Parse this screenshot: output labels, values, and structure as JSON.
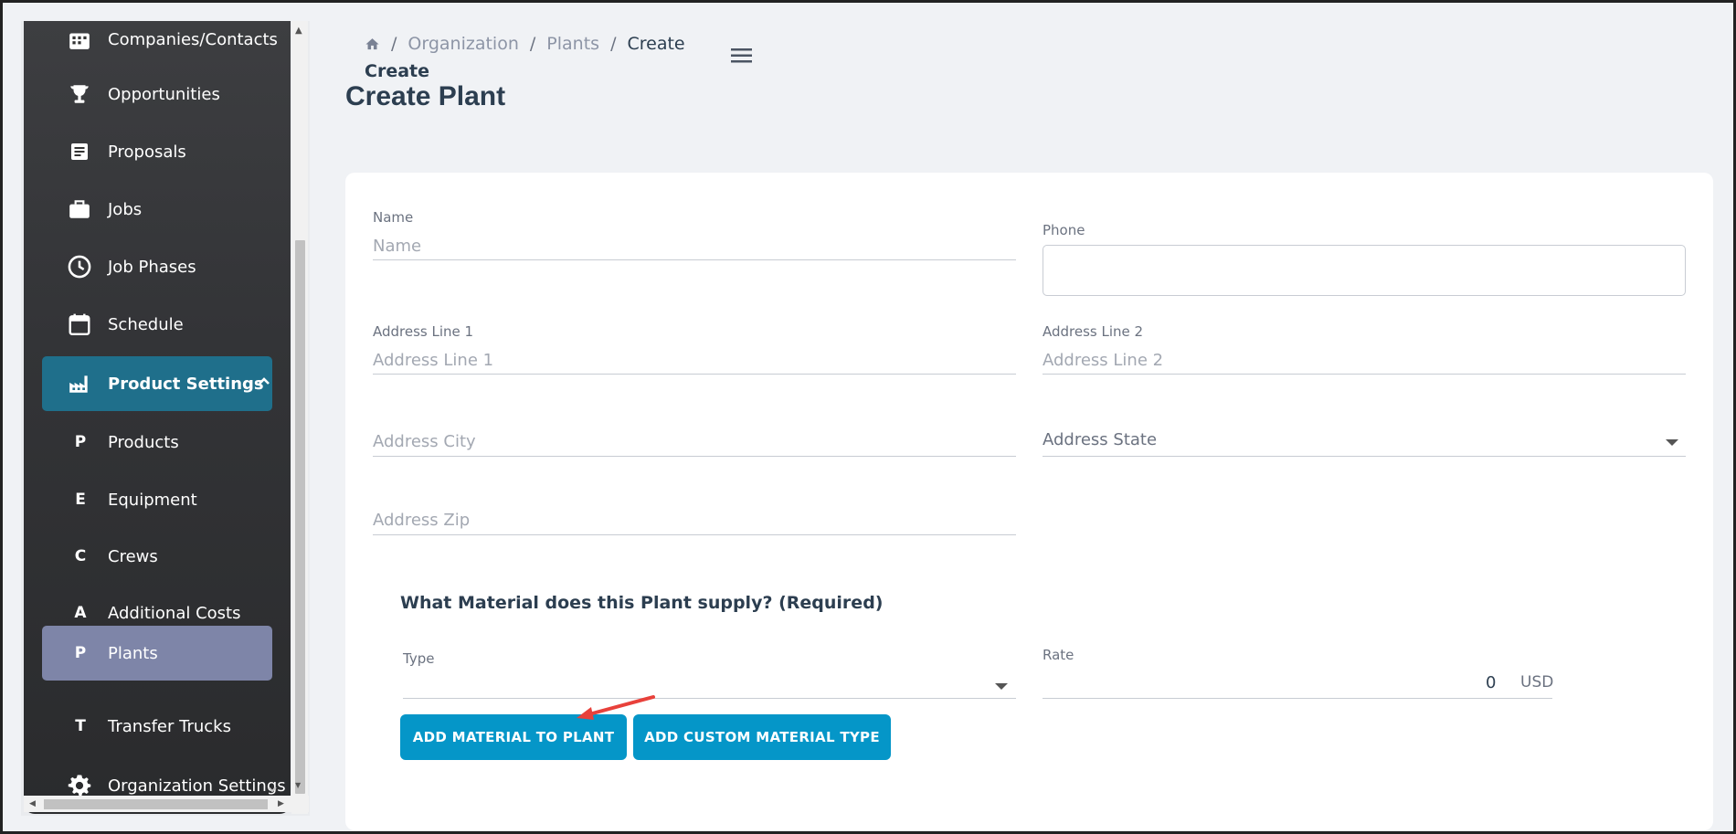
{
  "sidebar": {
    "items": [
      {
        "label": "Companies/Contacts",
        "icon": "grid-icon"
      },
      {
        "label": "Opportunities",
        "icon": "trophy-icon"
      },
      {
        "label": "Proposals",
        "icon": "document-icon"
      },
      {
        "label": "Jobs",
        "icon": "briefcase-icon"
      },
      {
        "label": "Job Phases",
        "icon": "clock-icon"
      },
      {
        "label": "Schedule",
        "icon": "calendar-icon"
      },
      {
        "label": "Product Settings",
        "icon": "factory-icon"
      },
      {
        "label": "Products",
        "letter": "P"
      },
      {
        "label": "Equipment",
        "letter": "E"
      },
      {
        "label": "Crews",
        "letter": "C"
      },
      {
        "label": "Additional Costs",
        "letter": "A"
      },
      {
        "label": "Plants",
        "letter": "P"
      },
      {
        "label": "Transfer Trucks",
        "letter": "T"
      },
      {
        "label": "Organization Settings",
        "icon": "gear-icon"
      }
    ]
  },
  "breadcrumb": {
    "items": [
      "Organization",
      "Plants",
      "Create"
    ],
    "current_second_line": "Create"
  },
  "page_title": "Create Plant",
  "form": {
    "name": {
      "label": "Name",
      "placeholder": "Name"
    },
    "phone": {
      "label": "Phone",
      "value": ""
    },
    "address1": {
      "label": "Address Line 1",
      "placeholder": "Address Line 1"
    },
    "address2": {
      "label": "Address Line 2",
      "placeholder": "Address Line 2"
    },
    "city": {
      "placeholder": "Address City"
    },
    "state": {
      "placeholder": "Address State"
    },
    "zip": {
      "placeholder": "Address Zip"
    }
  },
  "material": {
    "title": "What Material does this Plant supply? (Required)",
    "type_label": "Type",
    "rate_label": "Rate",
    "rate_value": "0",
    "rate_unit": "USD",
    "add_button": "ADD MATERIAL TO PLANT",
    "custom_button": "ADD CUSTOM MATERIAL TYPE"
  },
  "colors": {
    "active_parent": "#1f6f8b",
    "active_item": "#7e85a8",
    "button": "#0596c8",
    "annotation_arrow": "#e8413b"
  }
}
